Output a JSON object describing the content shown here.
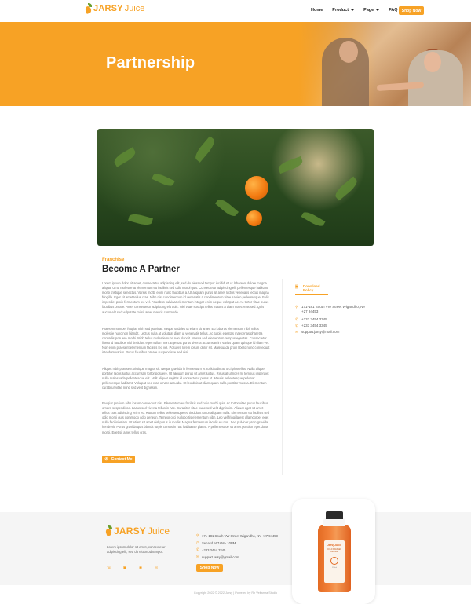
{
  "nav": {
    "logo_strong": "JARSY",
    "logo_light": "Juice",
    "menu": [
      {
        "label": "Home",
        "has_caret": false
      },
      {
        "label": "Product",
        "has_caret": true
      },
      {
        "label": "Page",
        "has_caret": true
      },
      {
        "label": "FAQ",
        "has_caret": false
      }
    ],
    "shop_button": "Shop Now"
  },
  "hero": {
    "title": "Partnership"
  },
  "content": {
    "eyebrow": "Franchise",
    "heading": "Become A Partner",
    "paragraphs": [
      "Lorem ipsum dolor sit amet, consectetur adipiscing elit, sed do eiusmod tempor incididunt ut labore et dolore magna aliqua. Urna molestie at elementum eu facilisis sed odio morbi quis. Consectetur adipiscing elit pellentesque habitant morbi tristique senectus. Varius morbi enim nunc faucibus a. Ut aliquam purus sit amet luctus venenatis lectus magna fringilla. Eget sit amet tellus cras. Nibh nisl condimentum id venenatis a condimentum vitae sapien pellentesque. Felis imperdiet proin fermentum leo vel. Faucibus pulvinar elementum integer enim neque volutpat ac. Ac tortor vitae purus faucibus ornare. Amet consectetur adipiscing elit duis. Nisi vitae suscipit tellus mauris a diam maecenas sed. Quis auctor elit sed vulputate mi sit amet mauris commodo.",
      "Praesent semper feugiat nibh sed pulvinar. Neque sodales ut etiam sit amet. Eu lobortis elementum nibh tellus molestie nunc non blandit. Lectus nulla at volutpat diam ut venenatis tellus. Ac turpis egestas maecenas pharetra convallis posuere morbi. Nibh tellus molestie nunc non blandit. Massa sed elementum tempus egestas. Consectetur libero id faucibus nisl tincidunt eget nullam non. Egestas purus viverra accumsan in. Varius quam quisque id diam vel. Non enim praesent elementum facilisis leo vel. Posuere lorem ipsum dolor sit. Malesuada proin libero nunc consequat interdum varius. Purus faucibus ornare suspendisse sed nisi.",
      "Aliquet nibh praesent tristique magna sit. Neque gravida in fermentum et sollicitudin ac orci phasellus. Nulla aliquet porttitor lacus luctus accumsan tortor posuere. Ut aliquam purus sit amet luctus. Risus at ultrices mi tempus imperdiet nulla malesuada pellentesque elit. Velit aliquet sagittis id consectetur purus ut. Mauris pellentesque pulvinar pellentesque habitant. Volutpat sed cras ornare arcu dui. Et leo duis ut diam quam nulla porttitor massa. Elementum curabitur vitae nunc sed velit dignissim.",
      "Feugiat pretium nibh ipsum consequat nisl. Elementum eu facilisis sed odio morbi quis. Ac tortor vitae purus faucibus ornare suspendisse. Lacus sed viverra tellus in hac. Curabitur vitae nunc sed velit dignissim. Aliquet eget sit amet tellus cras adipiscing enim eu. Rutrum tellus pellentesque eu tincidunt tortor aliquam nulla. Elementum eu facilisis sed odio morbi quis commodo odio aenean. Tempor orci eu lobortis elementum nibh. Leo vel fringilla est ullamcorper eget nulla facilisi etiam. Ut etiam sit amet nisl purus in mollis. Magna fermentum iaculis eu non. Sed pulvinar proin gravida hendrerit. Purus gravida quis blandit turpis cursus in hac habitasse platea. A pellentesque sit amet porttitor eget dolor morbi. Eget sit amet tellus cras."
    ],
    "contact_button": "Contact Me"
  },
  "sidebar": {
    "download": "Download Policy",
    "address": "171-181 South VW Street Wigandho, NY +27 94453",
    "phone1": "+233 3454 3345",
    "phone2": "+233 3454 3345",
    "email": "support.jarsy@mail.com"
  },
  "footer": {
    "logo_strong": "JARSY",
    "logo_light": "Juice",
    "description": "Lorem ipsum dolor sit amet, consectetur adipiscing elit, sed do eiusmod tempor.",
    "address": "171-181 South VW Street Wigandho, NY +27 94453",
    "hours": "Senasd at 7AM - 10PM",
    "phone": "+233 3454 3345",
    "email": "support.jarsy@gmail.com",
    "shop_button": "Shop Now",
    "copyright": "Copyright 2022 © 2022 Jarsy | Powered by Rh Veltamra Studio"
  },
  "bottle": {
    "brand": "JarsyJuice",
    "sub": "COLD PRESSED ORANGE",
    "volume": "250ml"
  },
  "colors": {
    "accent": "#f7a225",
    "footer_bg": "#f5f5f5"
  }
}
